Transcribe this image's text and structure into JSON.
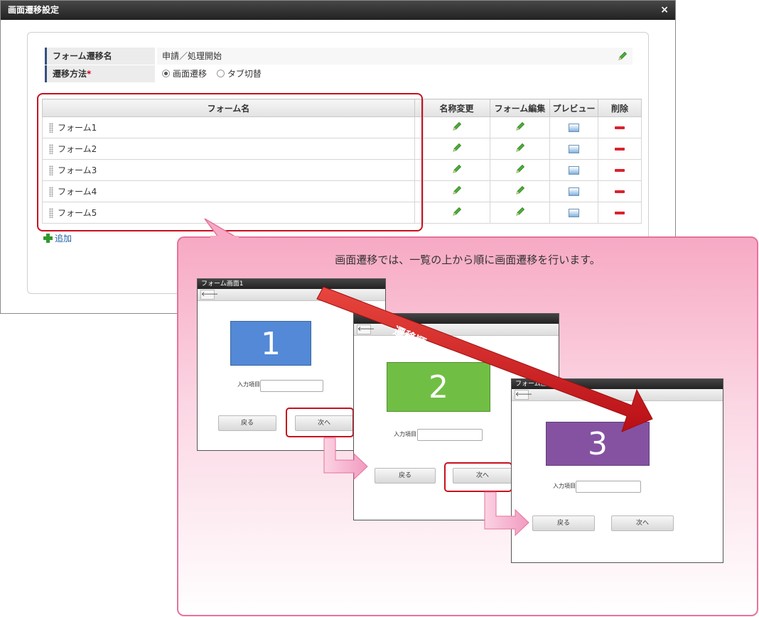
{
  "dialog": {
    "title": "画面遷移設定",
    "close_symbol": "×"
  },
  "fields": {
    "form_transition_name": {
      "label": "フォーム遷移名",
      "value": "申請／処理開始"
    },
    "transition_method": {
      "label": "遷移方法",
      "required_mark": "*",
      "options": [
        {
          "label": "画面遷移",
          "selected": true
        },
        {
          "label": "タブ切替",
          "selected": false
        }
      ]
    }
  },
  "table": {
    "headers": [
      "フォーム名",
      "",
      "名称変更",
      "フォーム編集",
      "プレビュー",
      "削除"
    ],
    "rows": [
      {
        "name": "フォーム1"
      },
      {
        "name": "フォーム2"
      },
      {
        "name": "フォーム3"
      },
      {
        "name": "フォーム4"
      },
      {
        "name": "フォーム5"
      }
    ]
  },
  "add_link": "追加",
  "callout": {
    "text": "画面遷移では、一覧の上から順に画面遷移を行います。",
    "order_label": "遷移順",
    "windows": [
      {
        "title": "フォーム画面1",
        "number": "1",
        "color": "#5389d6",
        "input_label": "入力項目",
        "back_label": "戻る",
        "next_label": "次へ"
      },
      {
        "title": "",
        "number": "2",
        "color": "#70bf44",
        "input_label": "入力項目",
        "back_label": "戻る",
        "next_label": "次へ"
      },
      {
        "title": "フォーム画面",
        "number": "3",
        "color": "#8552a1",
        "input_label": "入力項目",
        "back_label": "戻る",
        "next_label": "次へ"
      }
    ],
    "back_arrow_symbol": "🡐"
  },
  "colors": {
    "accent_red": "#c8101e",
    "edit_green": "#4caf38",
    "callout_border": "#e4739c"
  },
  "icons": {
    "edit": "pencil-icon",
    "preview": "preview-icon",
    "delete": "minus-icon",
    "add": "plus-icon",
    "drag": "drag-handle-icon"
  }
}
